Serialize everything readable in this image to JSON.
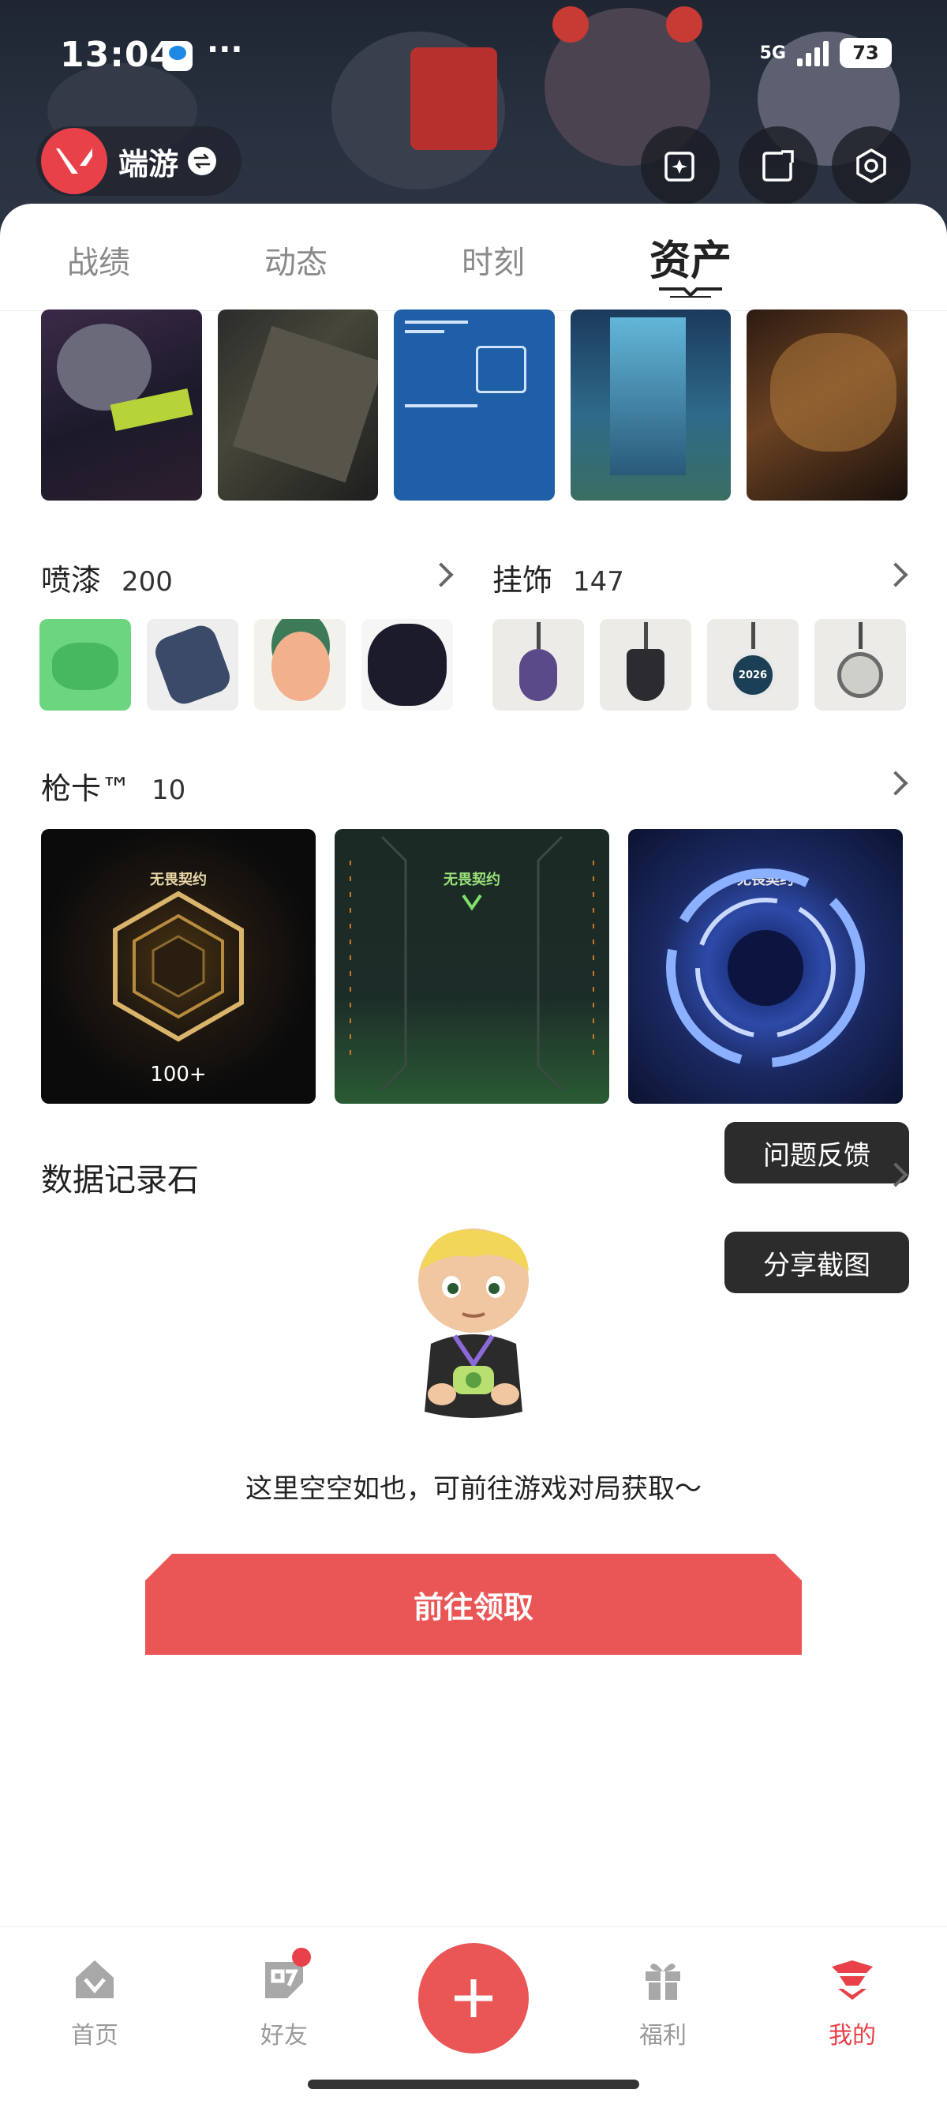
{
  "status_bar": {
    "time": "13:04",
    "dots": "···",
    "network": "5G",
    "battery": "73"
  },
  "account": {
    "name": "端游"
  },
  "tabs": [
    "战绩",
    "动态",
    "时刻",
    "资产"
  ],
  "active_tab": "资产",
  "sprays": {
    "title": "喷漆",
    "count": "200"
  },
  "charms": {
    "title": "挂饰",
    "count": "147",
    "charm3_text": "2026"
  },
  "gun_cards": {
    "title": "枪卡™",
    "count": "10",
    "brand": "无畏契约",
    "first_count": "100+"
  },
  "floating": {
    "feedback": "问题反馈",
    "share": "分享截图"
  },
  "record_stone": {
    "title": "数据记录石",
    "empty_text": "这里空空如也，可前往游戏对局获取～",
    "claim_button": "前往领取"
  },
  "bottom_nav": {
    "home": "首页",
    "friends": "好友",
    "benefits": "福利",
    "mine": "我的"
  },
  "colors": {
    "accent": "#e8414a",
    "button_red": "#ea5656",
    "dark_chip": "#2c2c2c"
  }
}
